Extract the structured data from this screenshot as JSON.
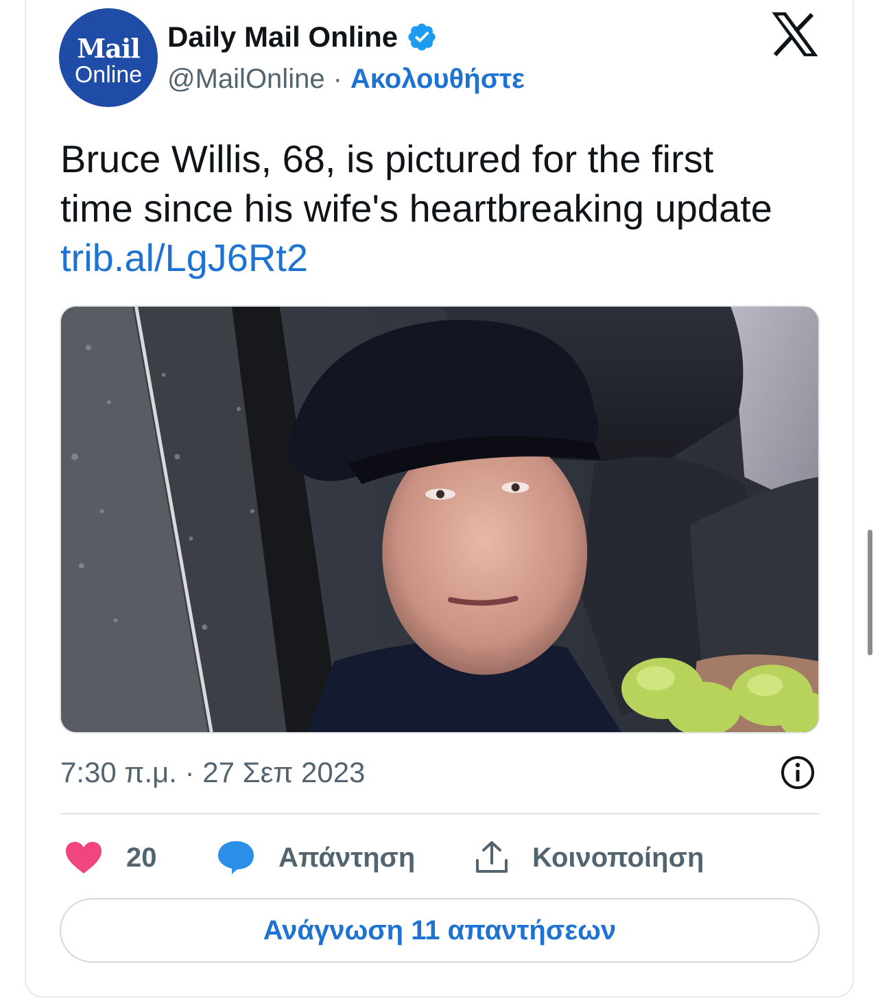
{
  "account": {
    "name": "Daily Mail Online",
    "handle": "@MailOnline",
    "separator": "·",
    "follow_label": "Ακολουθήστε",
    "avatar_line1": "Mail",
    "avatar_line2": "Online",
    "verified_icon": "verified-badge-icon"
  },
  "tweet": {
    "text_line1": "Bruce Willis, 68, is pictured for the first",
    "text_line2": "time since his wife's heartbreaking update",
    "link": "trib.al/LgJ6Rt2",
    "timestamp": "7:30 π.μ. · 27 Σεπ 2023"
  },
  "actions": {
    "like_count": "20",
    "reply_label": "Απάντηση",
    "share_label": "Κοινοποίηση"
  },
  "footer": {
    "read_replies_label": "Ανάγνωση 11 απαντήσεων"
  },
  "colors": {
    "brand_blue": "#1d72d2",
    "avatar_blue": "#1f4ca6",
    "heart_pink": "#f0457d",
    "reply_blue": "#2b8fe8",
    "secondary_text": "#536471"
  }
}
